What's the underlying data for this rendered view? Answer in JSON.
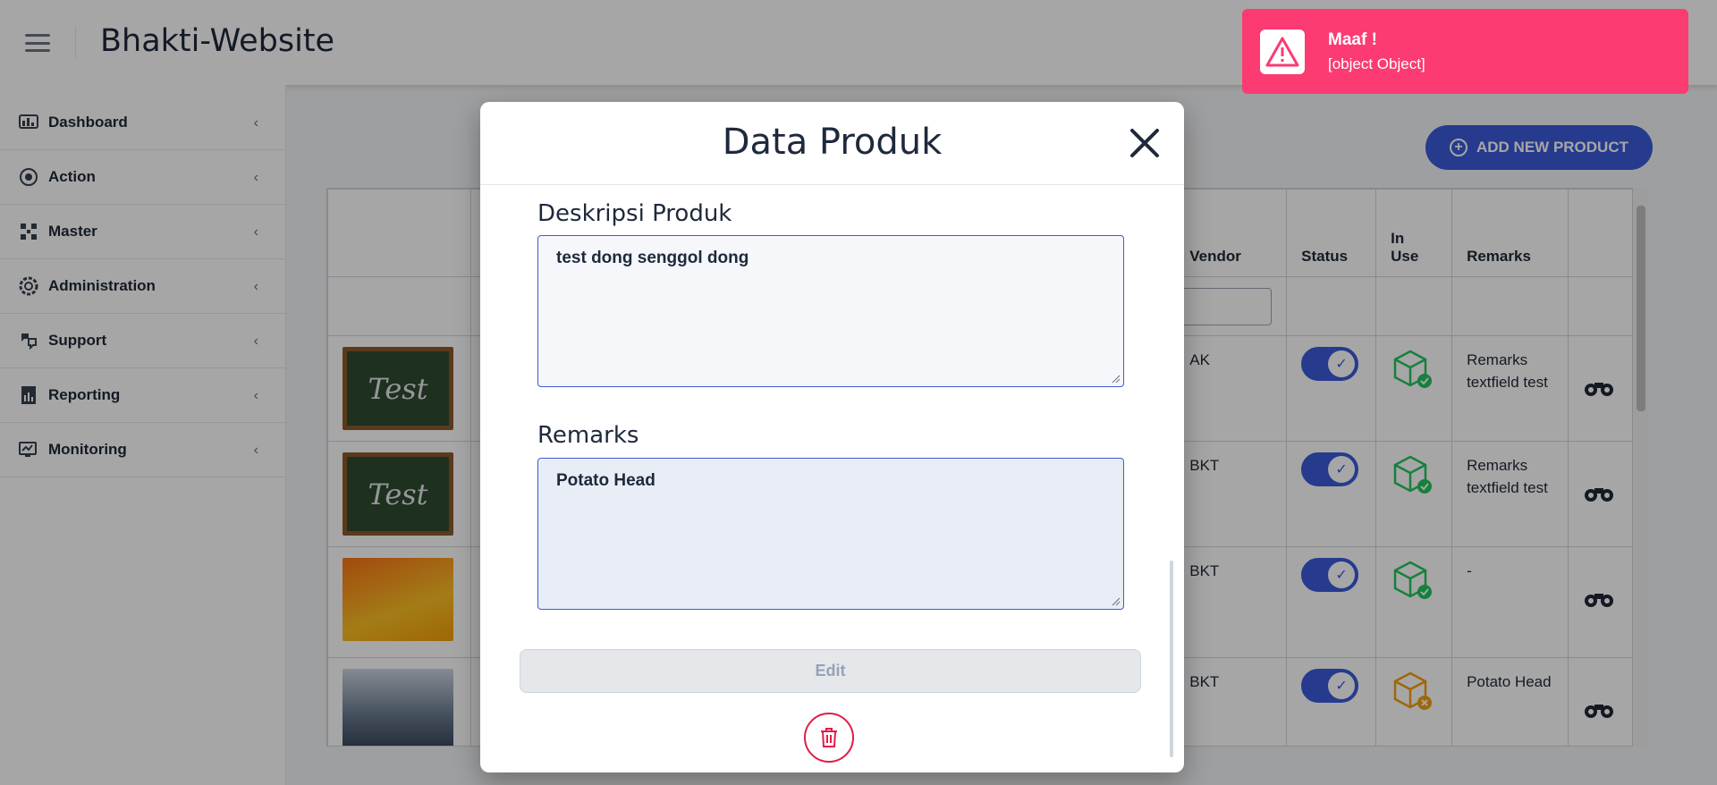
{
  "header": {
    "title": "Bhakti-Website"
  },
  "sidebar": {
    "items": [
      {
        "label": "Dashboard",
        "icon": "dashboard-icon"
      },
      {
        "label": "Action",
        "icon": "action-icon"
      },
      {
        "label": "Master",
        "icon": "master-icon"
      },
      {
        "label": "Administration",
        "icon": "administration-icon"
      },
      {
        "label": "Support",
        "icon": "support-icon"
      },
      {
        "label": "Reporting",
        "icon": "reporting-icon"
      },
      {
        "label": "Monitoring",
        "icon": "monitoring-icon"
      }
    ]
  },
  "main": {
    "add_button_label": "ADD NEW PRODUCT",
    "table": {
      "headers": {
        "vendor": "Vendor",
        "status": "Status",
        "in_use": "In Use",
        "in_use_line1": "In",
        "in_use_line2": "Use",
        "remarks": "Remarks"
      },
      "rows": [
        {
          "image": "Test",
          "vendor": "AK",
          "status": true,
          "in_use": true,
          "remarks": "Remarks textfield test"
        },
        {
          "image": "Test",
          "vendor": "BKT",
          "status": true,
          "in_use": true,
          "remarks": "Remarks textfield test"
        },
        {
          "image": "poster",
          "vendor": "BKT",
          "status": true,
          "in_use": true,
          "remarks": "-"
        },
        {
          "image": "store",
          "vendor": "BKT",
          "status": true,
          "in_use": false,
          "remarks": "Potato Head"
        }
      ]
    }
  },
  "modal": {
    "title": "Data Produk",
    "description_label": "Deskripsi Produk",
    "description_value": "test dong senggol dong",
    "remarks_label": "Remarks",
    "remarks_value": "Potato Head",
    "edit_label": "Edit"
  },
  "toast": {
    "title": "Maaf !",
    "message": "[object Object]",
    "color": "#fb3b71"
  },
  "colors": {
    "accent": "#3b5bdb",
    "danger": "#e11d48",
    "success": "#22c55e",
    "warning": "#f59e0b"
  }
}
